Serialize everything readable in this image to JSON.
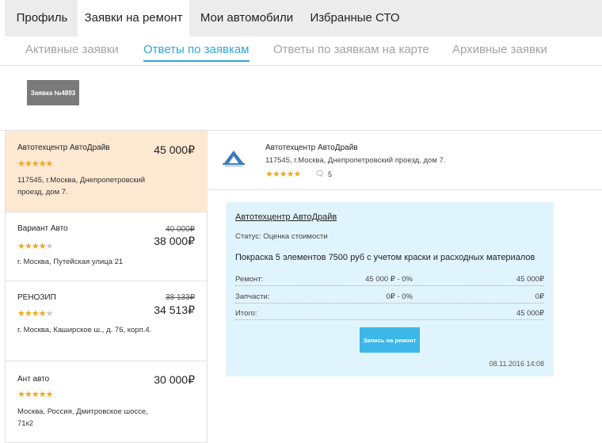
{
  "top_nav": [
    "Профиль",
    "Заявки на ремонт",
    "Мои автомобили",
    "Избранные СТО"
  ],
  "top_nav_active": 1,
  "sub_nav": [
    "Активные заявки",
    "Ответы по заявкам",
    "Ответы по заявкам на карте",
    "Архивные заявки"
  ],
  "sub_nav_active": 1,
  "order_button": "Заявка №4893",
  "offers": [
    {
      "name": "Автотехцентр АвтоДрайв",
      "price": "45 000₽",
      "old_price": "",
      "rating": 5,
      "address": "117545, г.Москва, Днепропетровский проезд, дом 7.",
      "selected": true
    },
    {
      "name": "Вариант Авто",
      "price": "38 000₽",
      "old_price": "40 000₽",
      "rating": 4,
      "address": "г. Москва, Путейская улица 21",
      "selected": false
    },
    {
      "name": "РЕНОЗИП",
      "price": "34 513₽",
      "old_price": "38 133₽",
      "rating": 4,
      "address": "г. Москва, Каширское ш., д. 76, корп.4.",
      "selected": false
    },
    {
      "name": "Ант авто",
      "price": "30 000₽",
      "old_price": "",
      "rating": 5,
      "address": "Москва, Россия, Дмитровское шоссе, 71к2",
      "selected": false
    }
  ],
  "company": {
    "name": "Автотехцентр АвтоДрайв",
    "address": "117545, г.Москва, Днепропетровский проезд, дом 7.",
    "rating": 5,
    "comments_count": "5",
    "logo_icon": "autodrive-logo"
  },
  "card": {
    "title": "Автотехцентр АвтоДрайв",
    "status": "Статус: Оценка стоимости",
    "description": "Покраска 5 элементов 7500 руб с учетом краски и расходных материалов",
    "rows": [
      {
        "label": "Ремонт:",
        "mid": "45 000 ₽ - 0%",
        "value": "45 000₽"
      },
      {
        "label": "Запчасти:",
        "mid": "0₽ - 0%",
        "value": "0₽"
      },
      {
        "label": "Итого:",
        "mid": "",
        "value": "45 000₽"
      }
    ],
    "button": "Запись на ремонт",
    "date": "08.11.2016 14:08"
  },
  "colors": {
    "accent": "#2fa7dc",
    "star": "#f4a61c",
    "selected_bg": "#fde8d2",
    "card_bg": "#e0f4fd",
    "button": "#3db6ea"
  }
}
